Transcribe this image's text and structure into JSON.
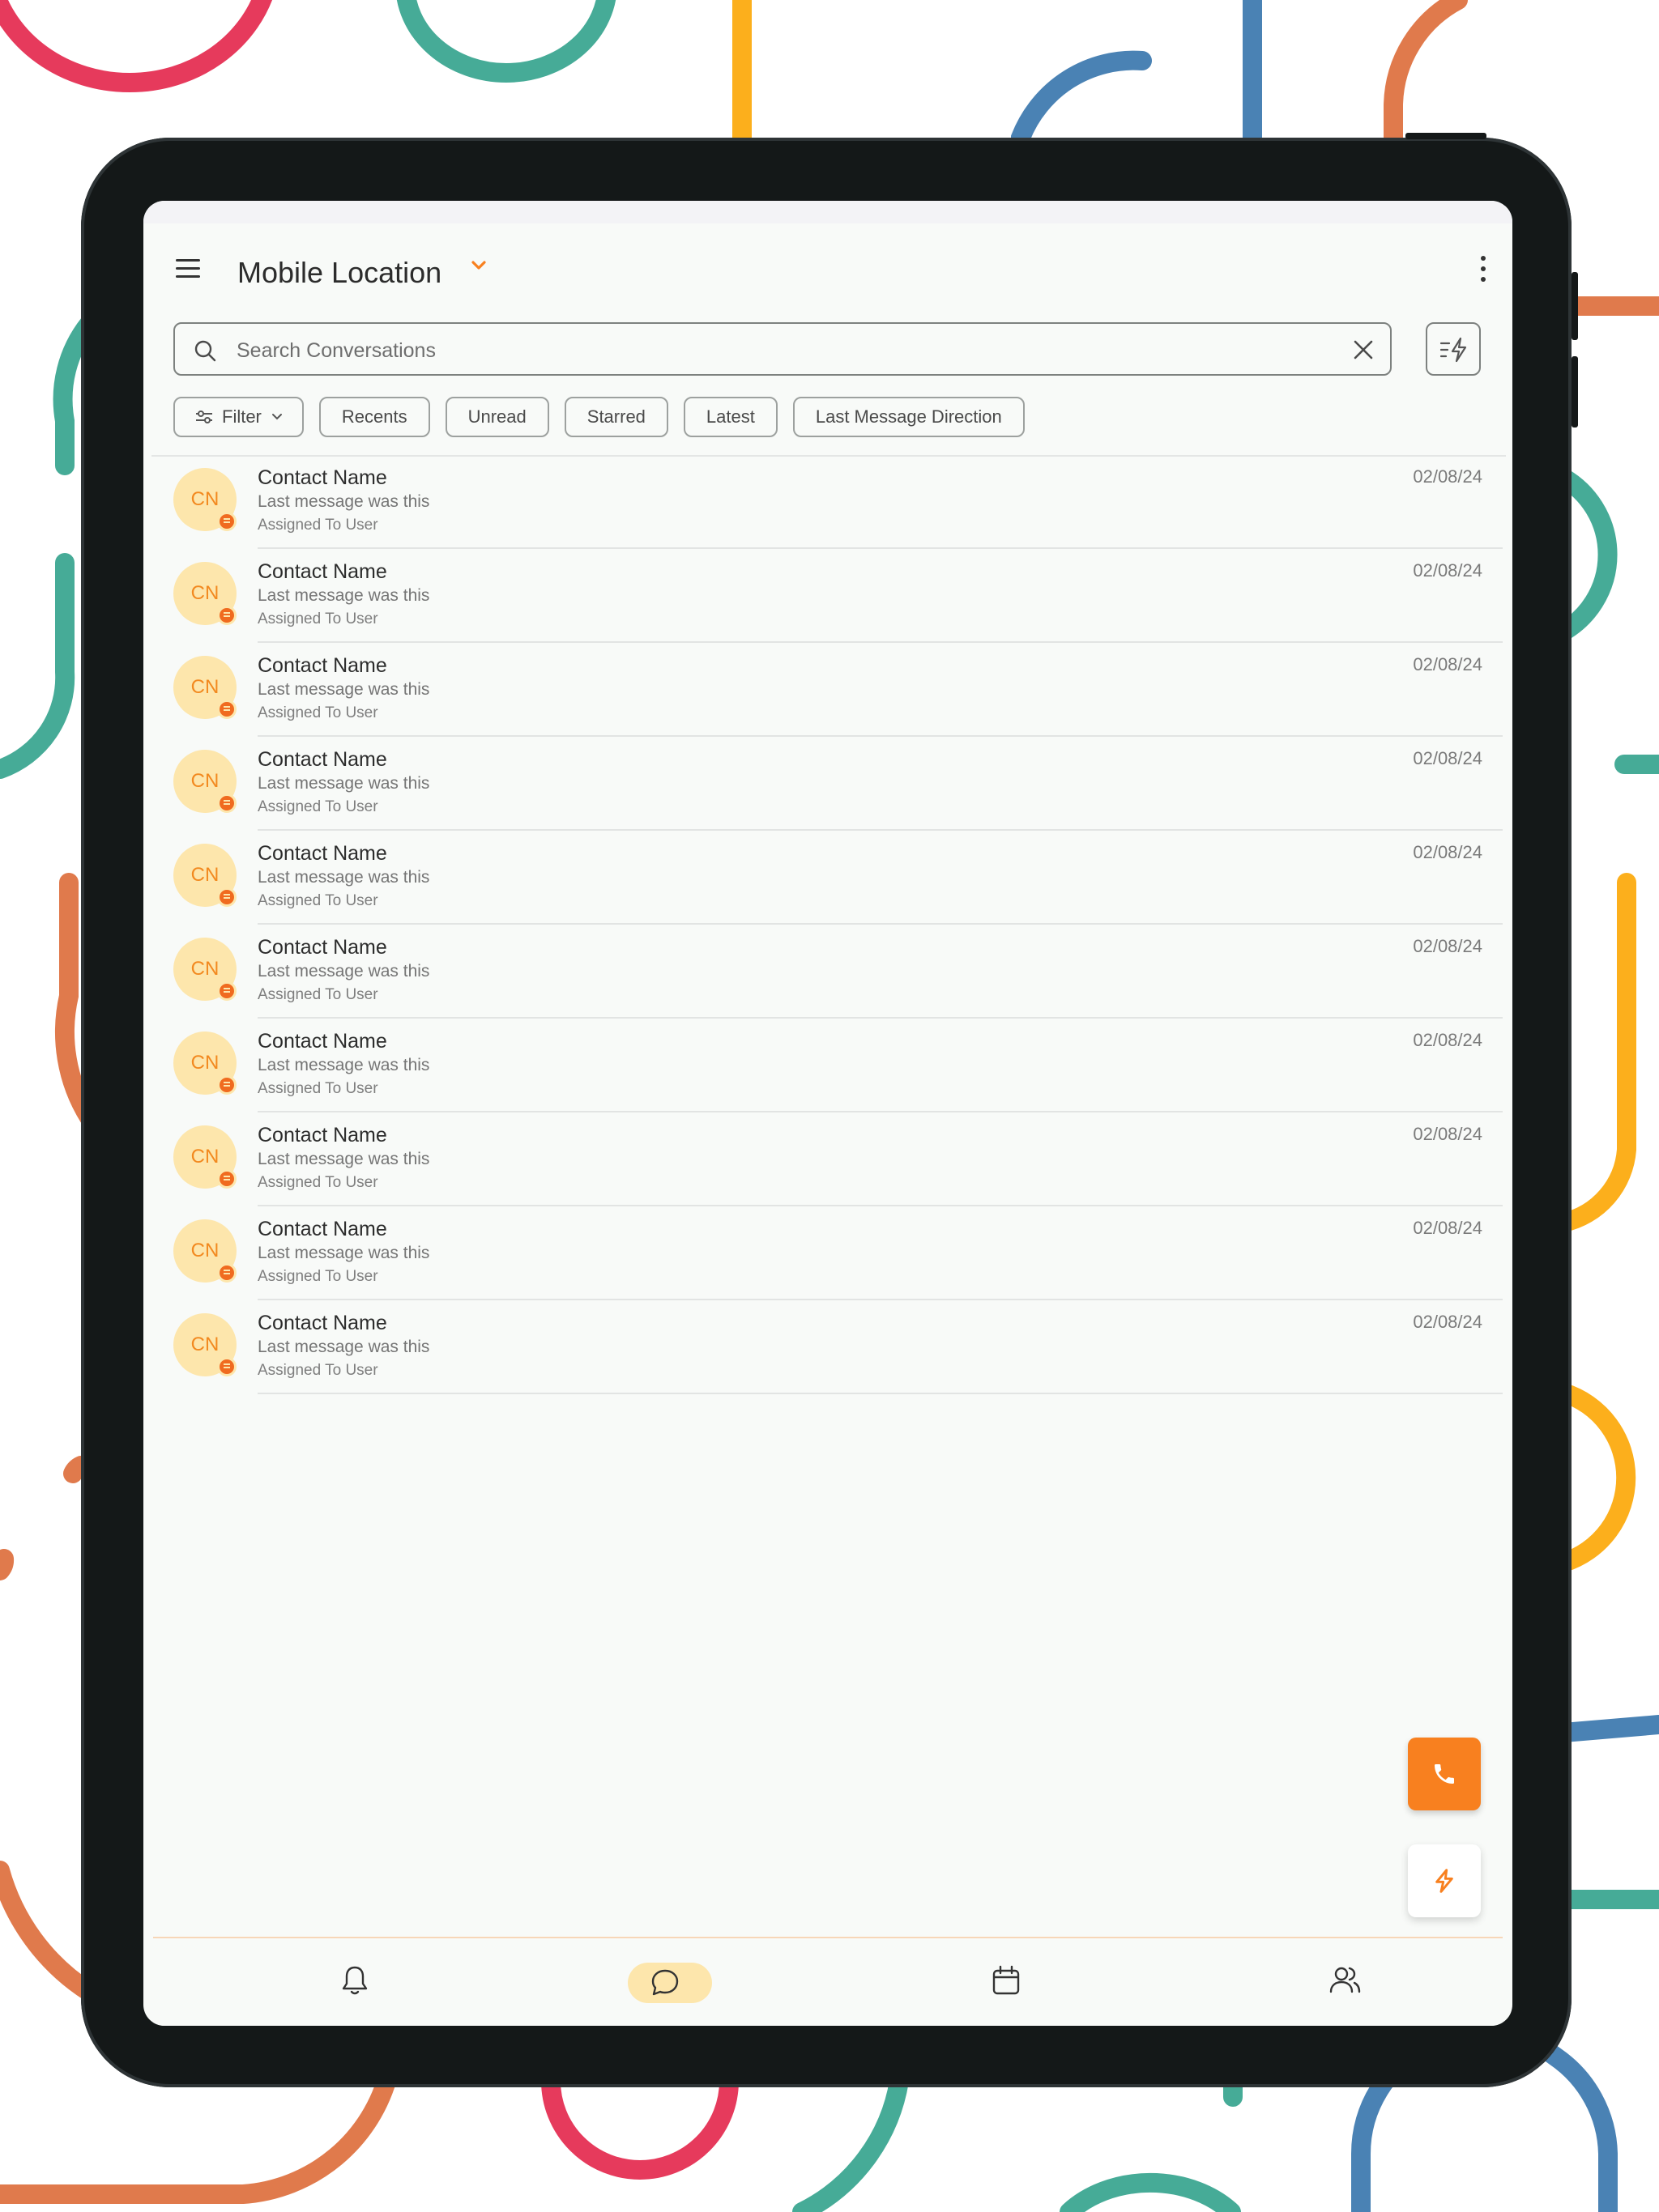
{
  "header": {
    "title": "Mobile Location"
  },
  "search": {
    "placeholder": "Search Conversations",
    "value": ""
  },
  "filters": {
    "filter_label": "Filter",
    "chips": [
      "Recents",
      "Unread",
      "Starred",
      "Latest",
      "Last Message Direction"
    ]
  },
  "conversations": [
    {
      "initials": "CN",
      "name": "Contact Name",
      "last_message": "Last message was this",
      "assigned": "Assigned To User",
      "date": "02/08/24"
    },
    {
      "initials": "CN",
      "name": "Contact Name",
      "last_message": "Last message was this",
      "assigned": "Assigned To User",
      "date": "02/08/24"
    },
    {
      "initials": "CN",
      "name": "Contact Name",
      "last_message": "Last message was this",
      "assigned": "Assigned To User",
      "date": "02/08/24"
    },
    {
      "initials": "CN",
      "name": "Contact Name",
      "last_message": "Last message was this",
      "assigned": "Assigned To User",
      "date": "02/08/24"
    },
    {
      "initials": "CN",
      "name": "Contact Name",
      "last_message": "Last message was this",
      "assigned": "Assigned To User",
      "date": "02/08/24"
    },
    {
      "initials": "CN",
      "name": "Contact Name",
      "last_message": "Last message was this",
      "assigned": "Assigned To User",
      "date": "02/08/24"
    },
    {
      "initials": "CN",
      "name": "Contact Name",
      "last_message": "Last message was this",
      "assigned": "Assigned To User",
      "date": "02/08/24"
    },
    {
      "initials": "CN",
      "name": "Contact Name",
      "last_message": "Last message was this",
      "assigned": "Assigned To User",
      "date": "02/08/24"
    },
    {
      "initials": "CN",
      "name": "Contact Name",
      "last_message": "Last message was this",
      "assigned": "Assigned To User",
      "date": "02/08/24"
    },
    {
      "initials": "CN",
      "name": "Contact Name",
      "last_message": "Last message was this",
      "assigned": "Assigned To User",
      "date": "02/08/24"
    }
  ],
  "bottom_nav": {
    "items": [
      {
        "icon": "bell-icon",
        "active": false
      },
      {
        "icon": "chat-bubble-icon",
        "active": true
      },
      {
        "icon": "calendar-icon",
        "active": false
      },
      {
        "icon": "users-icon",
        "active": false
      }
    ]
  },
  "colors": {
    "accent": "#f8801f",
    "avatar_bg": "#fde6ac",
    "badge": "#f06b1f",
    "screen_bg": "#f8faf8",
    "device_frame": "#141818"
  }
}
